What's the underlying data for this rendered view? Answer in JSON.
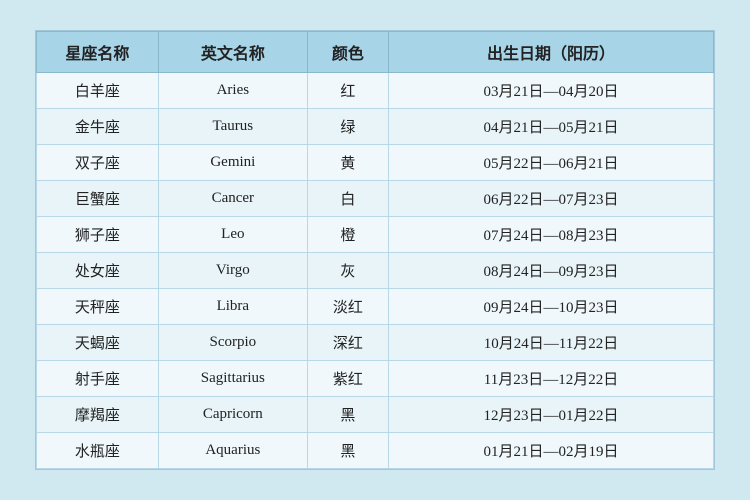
{
  "table": {
    "headers": [
      "星座名称",
      "英文名称",
      "颜色",
      "出生日期（阳历）"
    ],
    "rows": [
      {
        "chinese": "白羊座",
        "english": "Aries",
        "color": "红",
        "date": "03月21日—04月20日"
      },
      {
        "chinese": "金牛座",
        "english": "Taurus",
        "color": "绿",
        "date": "04月21日—05月21日"
      },
      {
        "chinese": "双子座",
        "english": "Gemini",
        "color": "黄",
        "date": "05月22日—06月21日"
      },
      {
        "chinese": "巨蟹座",
        "english": "Cancer",
        "color": "白",
        "date": "06月22日—07月23日"
      },
      {
        "chinese": "狮子座",
        "english": "Leo",
        "color": "橙",
        "date": "07月24日—08月23日"
      },
      {
        "chinese": "处女座",
        "english": "Virgo",
        "color": "灰",
        "date": "08月24日—09月23日"
      },
      {
        "chinese": "天秤座",
        "english": "Libra",
        "color": "淡红",
        "date": "09月24日—10月23日"
      },
      {
        "chinese": "天蝎座",
        "english": "Scorpio",
        "color": "深红",
        "date": "10月24日—11月22日"
      },
      {
        "chinese": "射手座",
        "english": "Sagittarius",
        "color": "紫红",
        "date": "11月23日—12月22日"
      },
      {
        "chinese": "摩羯座",
        "english": "Capricorn",
        "color": "黑",
        "date": "12月23日—01月22日"
      },
      {
        "chinese": "水瓶座",
        "english": "Aquarius",
        "color": "黑",
        "date": "01月21日—02月19日"
      }
    ]
  }
}
